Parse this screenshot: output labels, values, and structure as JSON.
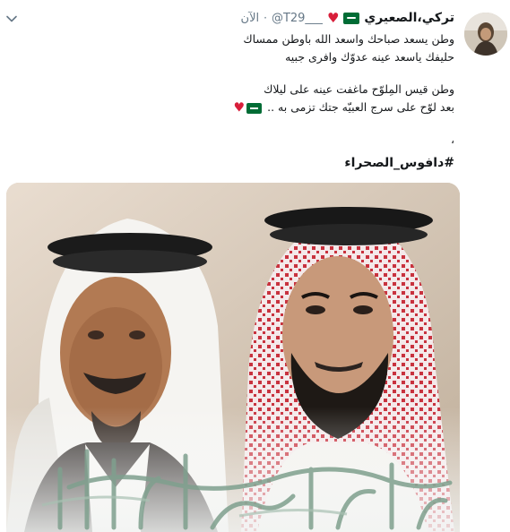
{
  "tweet": {
    "display_name": "تركي،الصعيري",
    "handle": "@T29___",
    "separator": "·",
    "time": "الآن",
    "lines": [
      "وطن يسعد صباحك واسعد الله باوطن ممساك",
      "حليفك ياسعد عينه عدوّك وافرى جبيه",
      "وطن قيس المِلوّح ماغفت عينه على ليلاك",
      "بعد لوّح على سرج العبيّه جتك تزمى به .."
    ],
    "comma": "،",
    "hashtag": "#دافوس_الصحراء"
  },
  "icons": {
    "verified_flag": "saudi-flag-icon",
    "heart": "red-heart-icon",
    "caret": "chevron-down-icon"
  },
  "colors": {
    "name": "#14171a",
    "meta": "#657786",
    "heart": "#d81e3a",
    "flag_green": "#006c35"
  }
}
